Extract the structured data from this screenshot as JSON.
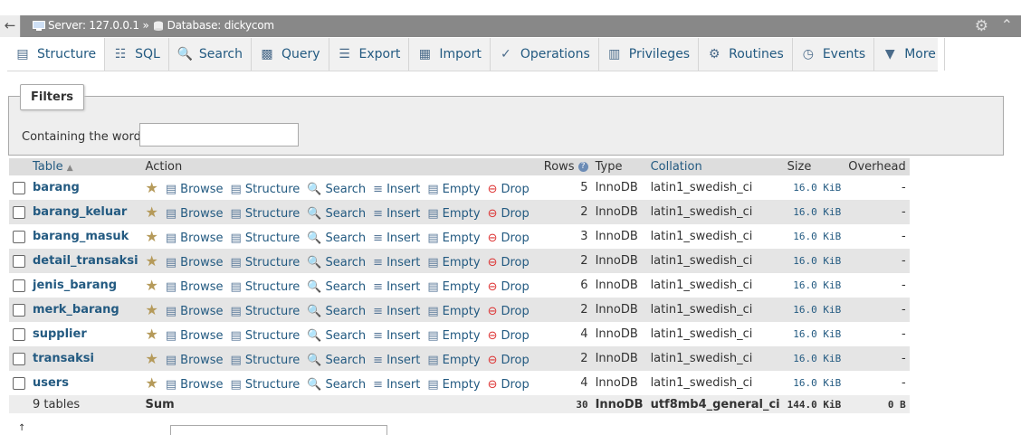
{
  "breadcrumb": {
    "server_label": "Server: 127.0.0.1 »",
    "database_label": "Database: dickycom"
  },
  "tabs": [
    {
      "label": "Structure",
      "icon": "structure-icon",
      "active": true
    },
    {
      "label": "SQL",
      "icon": "sql-icon"
    },
    {
      "label": "Search",
      "icon": "search-icon"
    },
    {
      "label": "Query",
      "icon": "query-icon"
    },
    {
      "label": "Export",
      "icon": "export-icon"
    },
    {
      "label": "Import",
      "icon": "import-icon"
    },
    {
      "label": "Operations",
      "icon": "wrench-icon"
    },
    {
      "label": "Privileges",
      "icon": "privileges-icon"
    },
    {
      "label": "Routines",
      "icon": "routines-icon"
    },
    {
      "label": "Events",
      "icon": "clock-icon"
    },
    {
      "label": "More",
      "icon": "caret-down-icon"
    }
  ],
  "filters": {
    "legend": "Filters",
    "label": "Containing the word:",
    "value": ""
  },
  "table_headers": {
    "table": "Table",
    "action": "Action",
    "rows": "Rows",
    "type": "Type",
    "collation": "Collation",
    "size": "Size",
    "overhead": "Overhead"
  },
  "actions": {
    "browse": "Browse",
    "structure": "Structure",
    "search": "Search",
    "insert": "Insert",
    "empty": "Empty",
    "drop": "Drop"
  },
  "rows": [
    {
      "name": "barang",
      "rows": "5",
      "type": "InnoDB",
      "collation": "latin1_swedish_ci",
      "size": "16.0 KiB",
      "overhead": "-"
    },
    {
      "name": "barang_keluar",
      "rows": "2",
      "type": "InnoDB",
      "collation": "latin1_swedish_ci",
      "size": "16.0 KiB",
      "overhead": "-"
    },
    {
      "name": "barang_masuk",
      "rows": "3",
      "type": "InnoDB",
      "collation": "latin1_swedish_ci",
      "size": "16.0 KiB",
      "overhead": "-"
    },
    {
      "name": "detail_transaksi",
      "rows": "2",
      "type": "InnoDB",
      "collation": "latin1_swedish_ci",
      "size": "16.0 KiB",
      "overhead": "-"
    },
    {
      "name": "jenis_barang",
      "rows": "6",
      "type": "InnoDB",
      "collation": "latin1_swedish_ci",
      "size": "16.0 KiB",
      "overhead": "-"
    },
    {
      "name": "merk_barang",
      "rows": "2",
      "type": "InnoDB",
      "collation": "latin1_swedish_ci",
      "size": "16.0 KiB",
      "overhead": "-"
    },
    {
      "name": "supplier",
      "rows": "4",
      "type": "InnoDB",
      "collation": "latin1_swedish_ci",
      "size": "16.0 KiB",
      "overhead": "-"
    },
    {
      "name": "transaksi",
      "rows": "2",
      "type": "InnoDB",
      "collation": "latin1_swedish_ci",
      "size": "16.0 KiB",
      "overhead": "-"
    },
    {
      "name": "users",
      "rows": "4",
      "type": "InnoDB",
      "collation": "latin1_swedish_ci",
      "size": "16.0 KiB",
      "overhead": "-"
    }
  ],
  "footer": {
    "count": "9 tables",
    "sum_label": "Sum",
    "rows": "30",
    "type": "InnoDB",
    "collation": "utf8mb4_general_ci",
    "size": "144.0 KiB",
    "overhead": "0 B"
  }
}
